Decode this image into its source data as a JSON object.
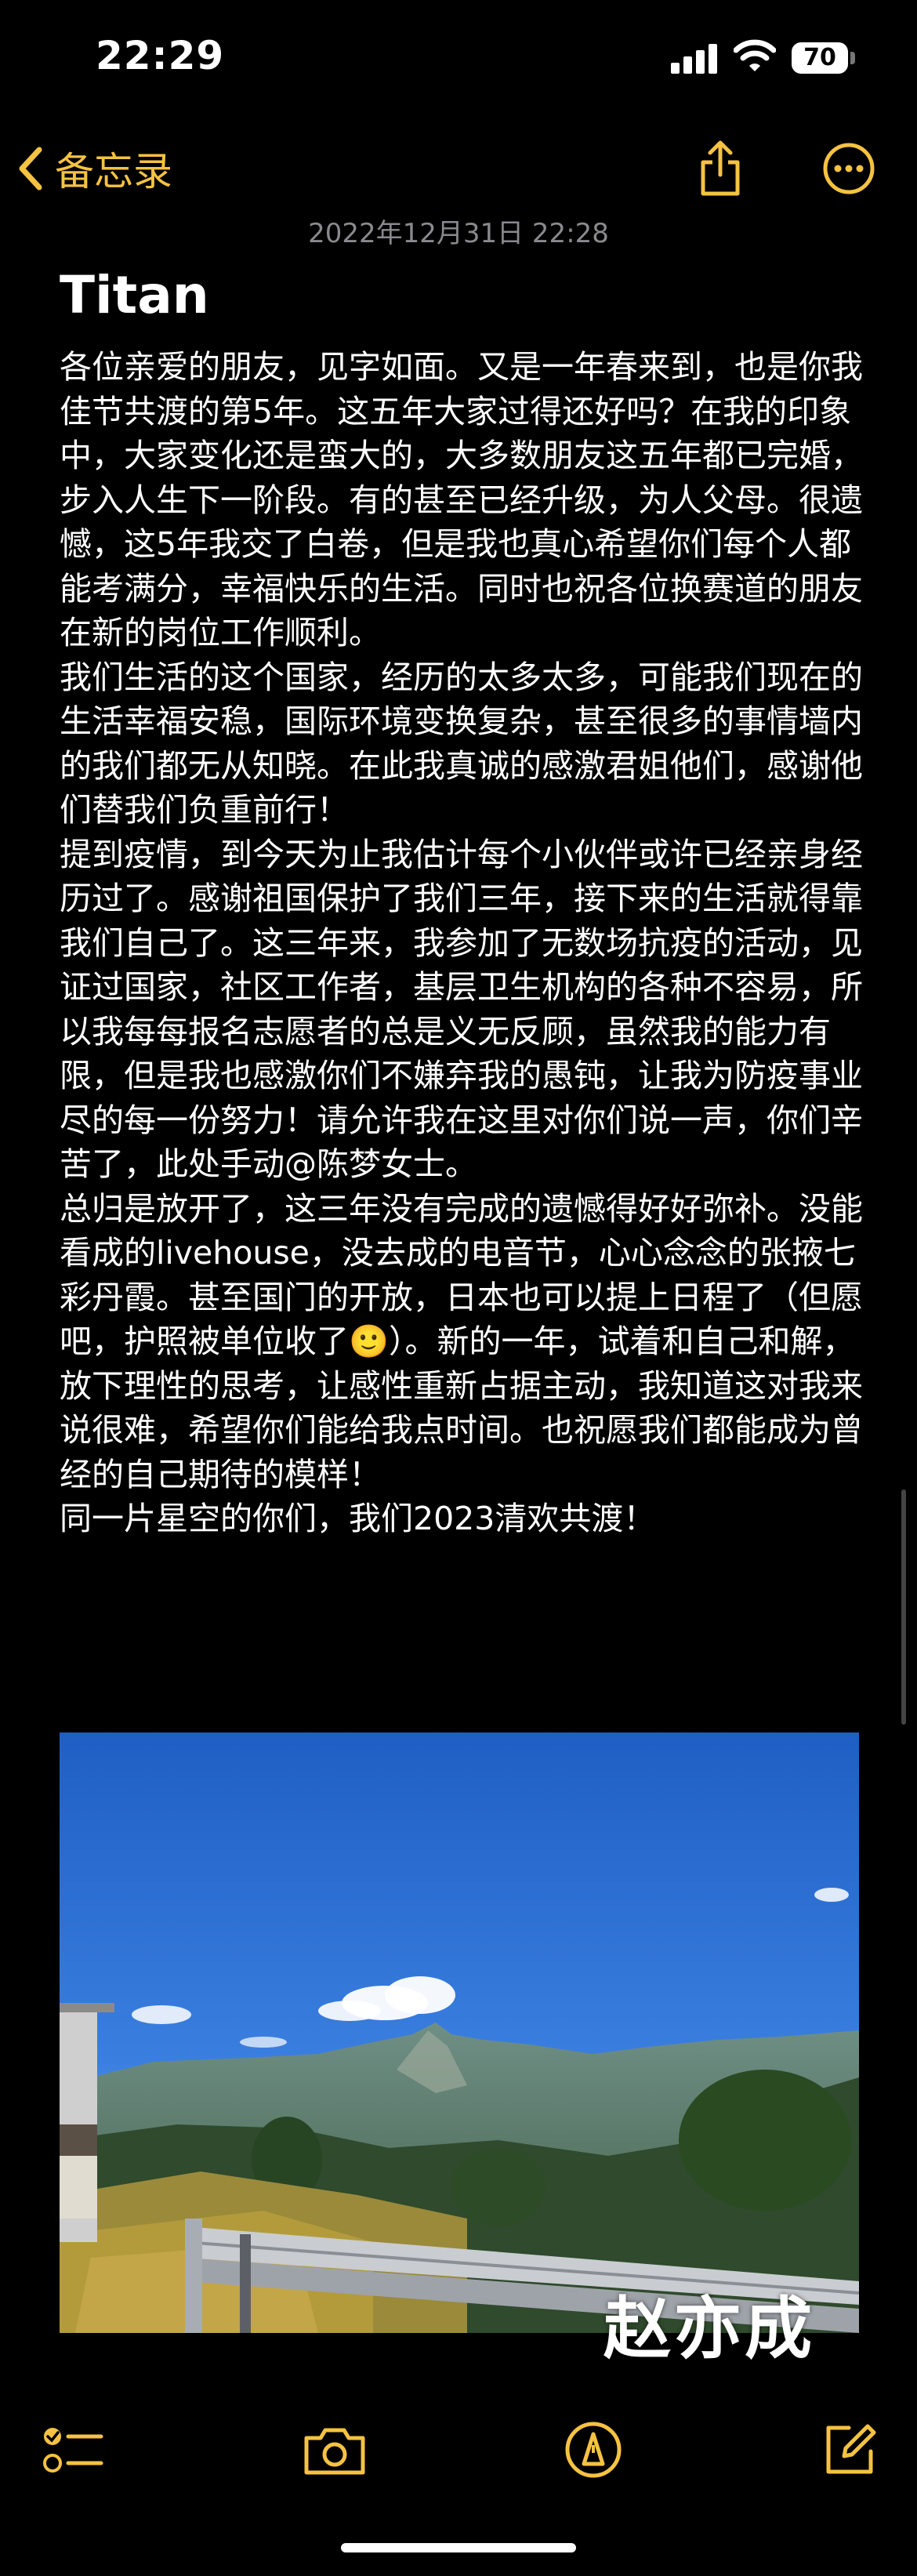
{
  "status_bar": {
    "time": "22:29",
    "battery": "70"
  },
  "nav": {
    "back_label": "备忘录",
    "share_icon": "share-icon",
    "more_icon": "more-icon"
  },
  "note": {
    "date": "2022年12月31日 22:28",
    "title": "Titan",
    "paragraphs": [
      "各位亲爱的朋友，见字如面。又是一年春来到，也是你我佳节共渡的第5年。这五年大家过得还好吗？在我的印象中，大家变化还是蛮大的，大多数朋友这五年都已完婚，步入人生下一阶段。有的甚至已经升级，为人父母。很遗憾，这5年我交了白卷，但是我也真心希望你们每个人都能考满分，幸福快乐的生活。同时也祝各位换赛道的朋友在新的岗位工作顺利。",
      "我们生活的这个国家，经历的太多太多，可能我们现在的生活幸福安稳，国际环境变换复杂，甚至很多的事情墙内的我们都无从知晓。在此我真诚的感激君姐他们，感谢他们替我们负重前行！",
      "提到疫情，到今天为止我估计每个小伙伴或许已经亲身经历过了。感谢祖国保护了我们三年，接下来的生活就得靠我们自己了。这三年来，我参加了无数场抗疫的活动，见证过国家，社区工作者，基层卫生机构的各种不容易，所以我每每报名志愿者的总是义无反顾，虽然我的能力有限，但是我也感激你们不嫌弃我的愚钝，让我为防疫事业尽的每一份努力！请允许我在这里对你们说一声，你们辛苦了，此处手动@陈梦女士。",
      "总归是放开了，这三年没有完成的遗憾得好好弥补。没能看成的livehouse，没去成的电音节，心心念念的张掖七彩丹霞。甚至国门的开放，日本也可以提上日程了（但愿吧，护照被单位收了🙂）。新的一年，试着和自己和解，放下理性的思考，让感性重新占据主动，我知道这对我来说很难，希望你们能给我点时间。也祝愿我们都能成为曾经的自己期待的模样！",
      "同一片星空的你们，我们2023清欢共渡！"
    ],
    "photo_watermark": "赵亦成"
  },
  "toolbar": {
    "checklist_icon": "checklist-icon",
    "camera_icon": "camera-icon",
    "markup_icon": "markup-pen-icon",
    "compose_icon": "compose-icon"
  },
  "colors": {
    "accent": "#f5c242",
    "background": "#000000",
    "date_gray": "#8a8a8e"
  }
}
